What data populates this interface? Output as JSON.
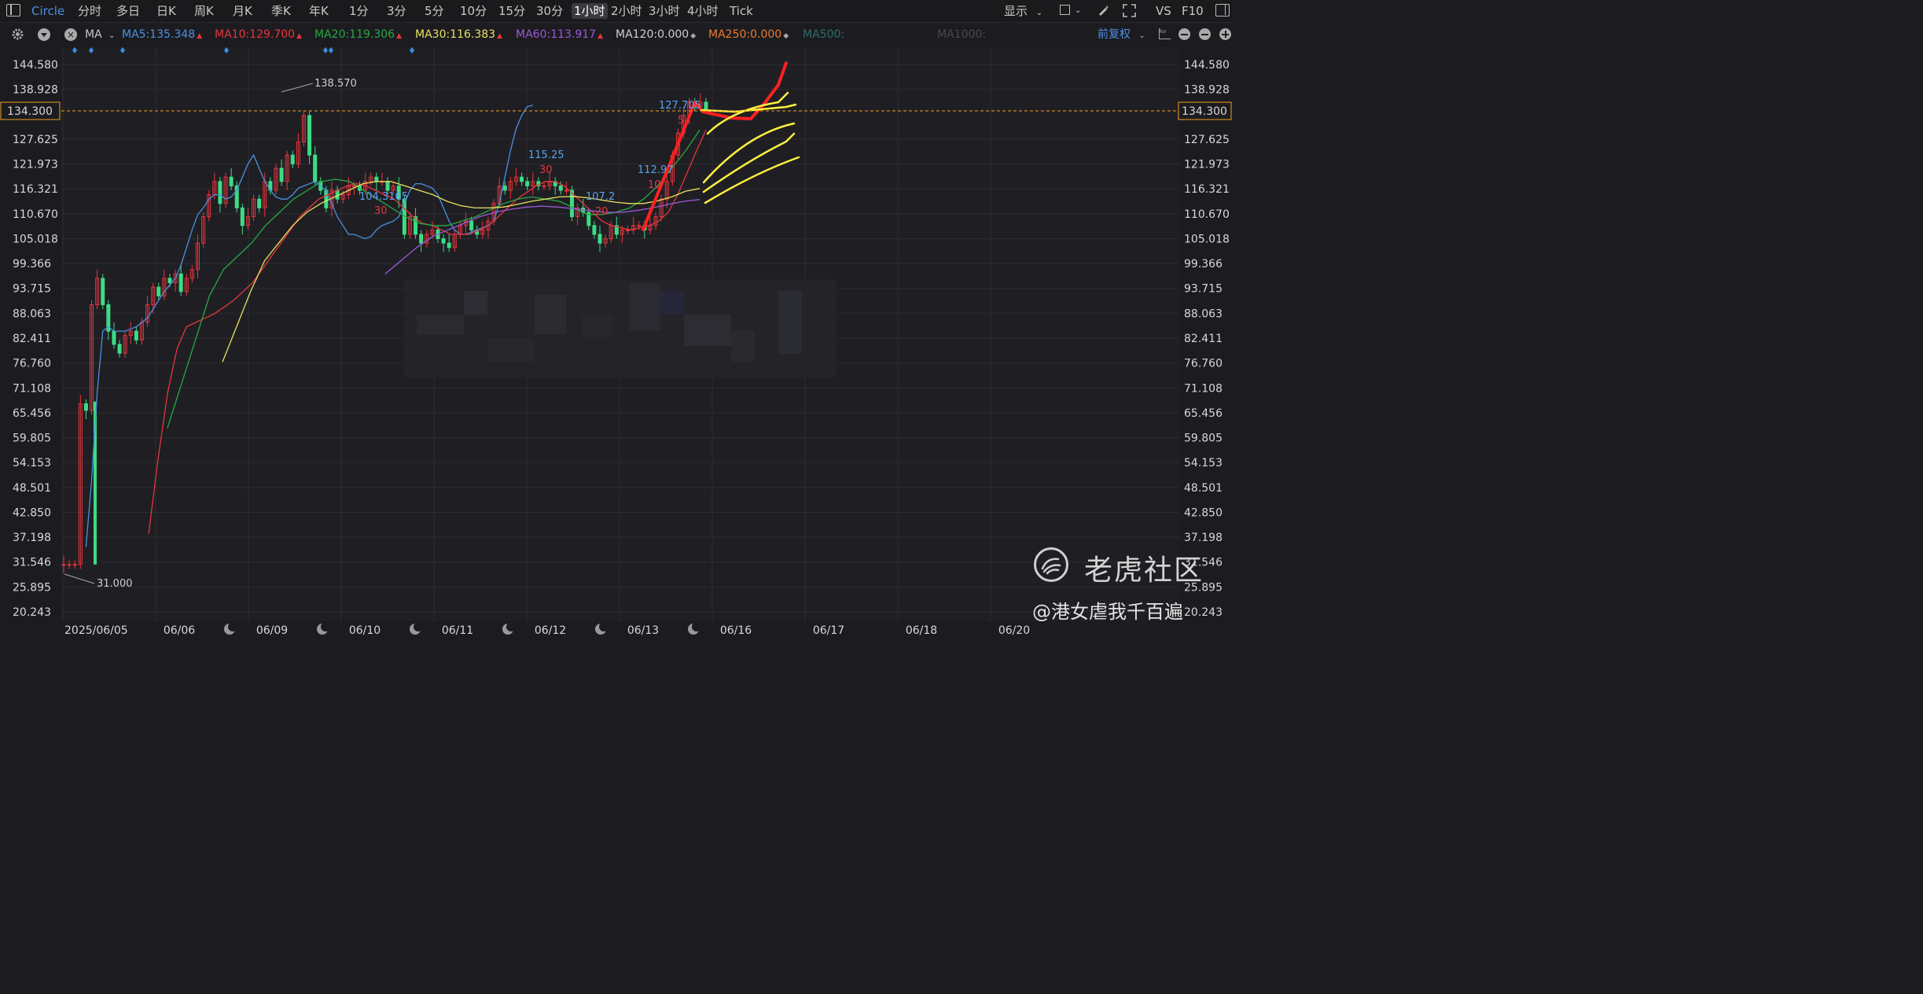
{
  "topbar": {
    "symbol": "Circle",
    "periods": [
      "分时",
      "多日",
      "日K",
      "周K",
      "月K",
      "季K",
      "年K",
      "1分",
      "3分",
      "5分",
      "10分",
      "15分",
      "30分",
      "1小时",
      "2小时",
      "3小时",
      "4小时",
      "Tick"
    ],
    "active_period": "1小时",
    "display_label": "显示",
    "vs_label": "VS",
    "f10_label": "F10"
  },
  "ma_bar": {
    "indicator": "MA",
    "items": [
      {
        "label": "MA5:135.348",
        "color": "#4a90e2",
        "trend": "up"
      },
      {
        "label": "MA10:129.700",
        "color": "#e8343c",
        "trend": "up"
      },
      {
        "label": "MA20:119.306",
        "color": "#27a844",
        "trend": "up"
      },
      {
        "label": "MA30:116.383",
        "color": "#e8e060",
        "trend": "up"
      },
      {
        "label": "MA60:113.917",
        "color": "#9b59d6",
        "trend": "up"
      },
      {
        "label": "MA120:0.000",
        "color": "#cfcfcf",
        "trend": "flat"
      },
      {
        "label": "MA250:0.000",
        "color": "#f07a30",
        "trend": "flat"
      },
      {
        "label": "MA500:",
        "color": "#2e6e6e",
        "trend": "none"
      },
      {
        "label": "MA1000:",
        "color": "#4a4a4a",
        "trend": "none"
      }
    ],
    "adjust_label": "前复权"
  },
  "chart_data": {
    "type": "candlestick",
    "y_ticks": [
      "144.580",
      "138.928",
      "127.625",
      "121.973",
      "116.321",
      "110.670",
      "105.018",
      "99.366",
      "93.715",
      "88.063",
      "82.411",
      "76.760",
      "71.108",
      "65.456",
      "59.805",
      "54.153",
      "48.501",
      "42.850",
      "37.198",
      "31.546",
      "25.895",
      "20.243"
    ],
    "ylim": [
      20.243,
      144.58
    ],
    "x_labels": [
      "2025/06/05",
      "06/06",
      "06/09",
      "06/10",
      "06/11",
      "06/12",
      "06/13",
      "06/16",
      "06/17",
      "06/18",
      "06/20"
    ],
    "current_price": "134.300",
    "annotations": {
      "high_label": "138.570",
      "low_label": "31.000",
      "point_a": "104.3165",
      "point_b": "115.25",
      "point_c": "107.2",
      "point_d": "112.97",
      "point_e": "127.705",
      "count_a": "30",
      "count_b": "30",
      "count_c": "20",
      "count_d": "10",
      "count_e": "5"
    },
    "closes": [
      31.0,
      31.0,
      31.0,
      67.5,
      66.0,
      90.0,
      96.0,
      90.0,
      84.0,
      81.0,
      79.0,
      83.0,
      84.0,
      82.0,
      86.0,
      90.0,
      94.0,
      92.0,
      96.0,
      95.0,
      97.0,
      93.0,
      96.0,
      98.0,
      104.0,
      110.0,
      115.0,
      118.0,
      113.0,
      119.0,
      117.0,
      112.0,
      108.0,
      110.0,
      114.0,
      112.0,
      118.0,
      116.0,
      121.0,
      118.0,
      124.0,
      122.0,
      127.0,
      133.0,
      124.0,
      118.0,
      116.0,
      112.0,
      116.0,
      114.0,
      115.0,
      117.0,
      117.0,
      116.0,
      118.0,
      119.0,
      118.0,
      118.0,
      116.0,
      117.0,
      114.0,
      106.0,
      110.0,
      106.0,
      104.0,
      106.0,
      107.0,
      105.0,
      104.0,
      103.0,
      106.0,
      108.0,
      109.0,
      107.0,
      106.0,
      107.0,
      109.0,
      113.0,
      117.0,
      116.0,
      118.0,
      119.0,
      118.0,
      117.0,
      118.0,
      117.0,
      117.0,
      118.0,
      117.0,
      116.0,
      116.0,
      110.0,
      112.0,
      111.0,
      108.0,
      106.0,
      104.0,
      105.0,
      108.0,
      106.0,
      107.0,
      107.0,
      108.0,
      108.0,
      107.0,
      108.0,
      110.0,
      114.0,
      118.0,
      124.0,
      129.0,
      133.0,
      136.0,
      135.0,
      136.0,
      134.3
    ],
    "ma5": [
      null,
      null,
      null,
      null,
      35.0,
      50.0,
      70.0,
      84.0,
      85.0,
      84.0,
      84.0,
      84.0,
      84.5,
      85.0,
      86.0,
      87.0,
      89.0,
      91.0,
      93.0,
      94.5,
      96.0,
      99.0,
      103.0,
      107.0,
      110.5,
      112.0,
      114.0,
      115.0,
      115.0,
      114.0,
      114.5,
      116.0,
      119.0,
      122.0,
      124.0,
      121.0,
      118.0,
      116.0,
      114.5,
      114.0,
      114.0,
      115.0,
      116.5,
      117.0,
      117.5,
      118.0,
      117.0,
      116.0,
      113.0,
      110.0,
      108.0,
      106.0,
      106.0,
      105.5,
      105.0,
      105.5,
      107.0,
      108.0,
      108.5,
      109.0,
      110.0,
      113.0,
      116.0,
      117.5,
      117.5,
      117.0,
      116.5,
      115.0,
      112.0,
      109.0,
      107.0,
      106.0,
      106.0,
      106.5,
      107.0,
      107.5,
      108.0,
      109.0,
      113.0,
      119.0,
      125.0,
      130.0,
      133.0,
      135.0,
      135.3
    ],
    "ma10": [
      null,
      null,
      null,
      null,
      null,
      null,
      null,
      null,
      null,
      38.0,
      55.0,
      70.0,
      80.0,
      85.0,
      86.0,
      87.0,
      88.0,
      89.5,
      91.0,
      93.0,
      95.0,
      98.0,
      101.0,
      104.0,
      107.0,
      110.0,
      112.0,
      114.0,
      115.0,
      116.0,
      117.0,
      117.5,
      117.0,
      116.0,
      115.0,
      114.0,
      112.0,
      110.0,
      108.5,
      108.0,
      107.0,
      106.0,
      106.0,
      106.0,
      107.0,
      108.0,
      110.0,
      112.0,
      114.0,
      115.5,
      117.0,
      118.0,
      118.0,
      117.0,
      115.0,
      113.0,
      111.0,
      109.0,
      108.0,
      107.5,
      107.0,
      107.5,
      108.0,
      109.0,
      111.0,
      115.0,
      120.0,
      125.0,
      129.7
    ],
    "grid_on": true
  }
}
